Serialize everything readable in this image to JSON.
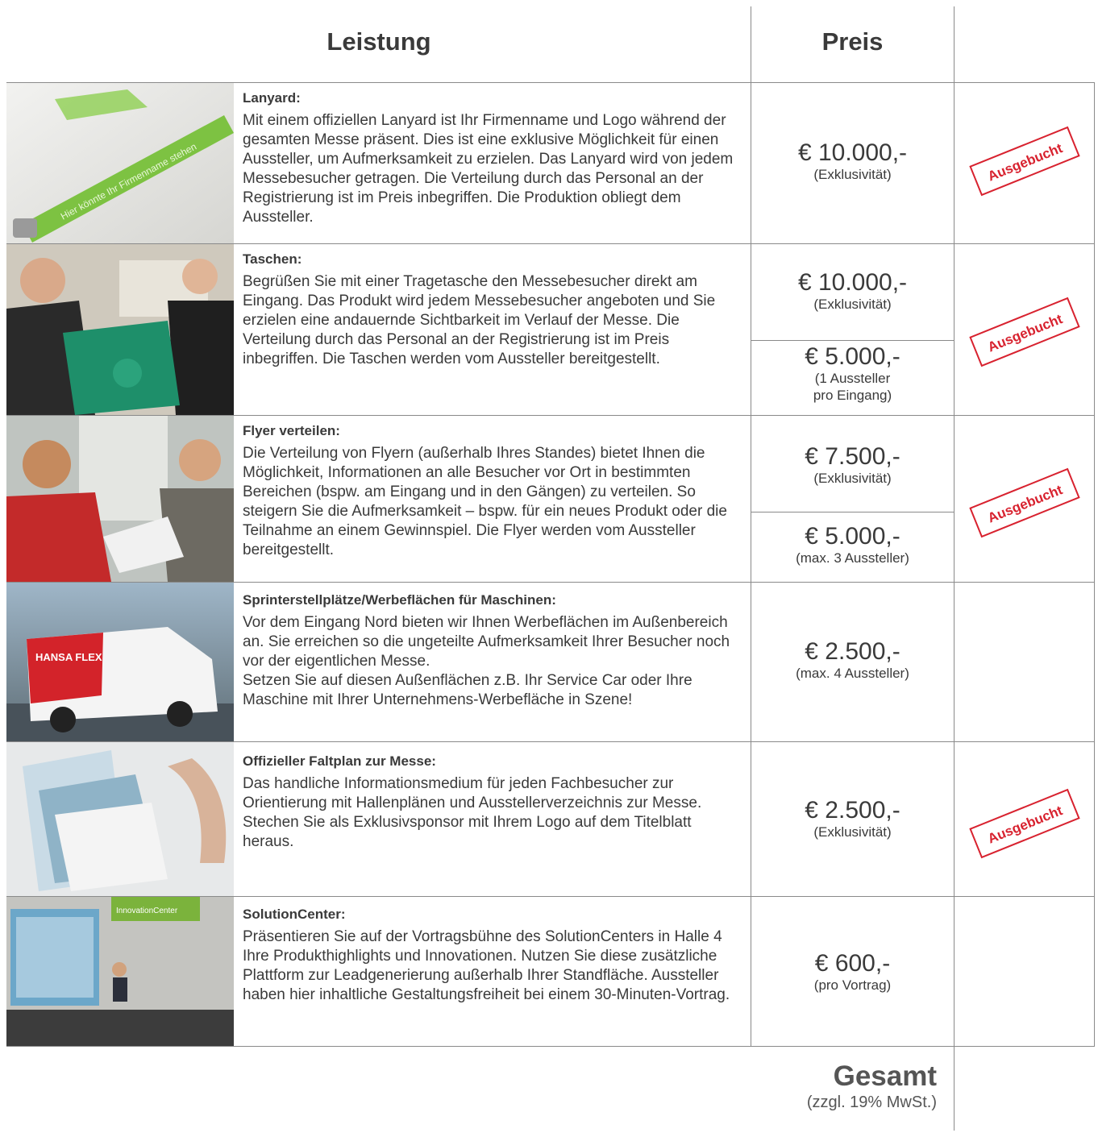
{
  "header": {
    "leistung": "Leistung",
    "preis": "Preis"
  },
  "rows": [
    {
      "title": "Lanyard:",
      "text": "Mit einem offiziellen Lanyard ist Ihr Firmenname und Logo während der gesamten Messe präsent. Dies ist eine exklusive Möglichkeit für einen Aussteller, um Aufmerksamkeit zu erzielen. Das Lanyard wird von jedem Messebesucher getragen. Die Verteilung durch das Personal an der Registrierung ist im Preis inbegriffen. Die Produktion obliegt dem Aussteller.",
      "lanyard_print": "Hier könnte Ihr Firmenname stehen",
      "prices": [
        {
          "amount": "€ 10.000,-",
          "note": "(Exklusivität)"
        }
      ],
      "status": "Ausgebucht"
    },
    {
      "title": "Taschen:",
      "text": "Begrüßen Sie mit einer Tragetasche den Messebesucher direkt am Eingang. Das Produkt wird jedem Messebesucher angeboten und Sie erzielen eine andauernde Sichtbarkeit im Verlauf der Messe. Die Verteilung durch das Personal an der Registrierung ist im Preis inbegriffen. Die Taschen werden vom Aussteller bereitgestellt.",
      "prices": [
        {
          "amount": "€ 10.000,-",
          "note": "(Exklusivität)"
        },
        {
          "amount": "€ 5.000,-",
          "note": "(1 Aussteller\npro Eingang)"
        }
      ],
      "status": "Ausgebucht"
    },
    {
      "title": "Flyer verteilen:",
      "text": "Die Verteilung von Flyern (außerhalb Ihres Standes) bietet Ihnen die Möglichkeit, Informationen an alle Besucher vor Ort in bestimmten Bereichen (bspw. am Eingang und in den Gängen) zu verteilen. So steigern Sie die Aufmerksamkeit – bspw. für ein neues Produkt oder die Teilnahme an einem Gewinnspiel. Die Flyer werden vom Aussteller bereitgestellt.",
      "prices": [
        {
          "amount": "€ 7.500,-",
          "note": "(Exklusivität)"
        },
        {
          "amount": "€ 5.000,-",
          "note": "(max. 3 Aussteller)"
        }
      ],
      "status": "Ausgebucht"
    },
    {
      "title": "Sprinterstellplätze/Werbeflächen für Maschinen:",
      "text": "Vor dem Eingang Nord bieten wir Ihnen Werbeflächen im Außenbereich an. Sie erreichen so die ungeteilte Aufmerksamkeit Ihrer Besucher noch vor der eigentlichen Messe.\nSetzen Sie auf diesen Außenflächen z.B. Ihr Service Car oder Ihre Maschine mit Ihrer Unternehmens-Werbefläche in Szene!",
      "van_logo": "HANSA FLEX",
      "prices": [
        {
          "amount": "€ 2.500,-",
          "note": "(max. 4 Aussteller)"
        }
      ],
      "status": ""
    },
    {
      "title": "Offizieller Faltplan zur Messe:",
      "text": "Das handliche Informationsmedium für jeden Fachbesucher zur Orientierung mit Hallenplänen und Ausstellerverzeichnis zur Messe. Stechen Sie als Exklusivsponsor mit Ihrem Logo auf dem Titelblatt heraus.",
      "prices": [
        {
          "amount": "€ 2.500,-",
          "note": "(Exklusivität)"
        }
      ],
      "status": "Ausgebucht"
    },
    {
      "title": "SolutionCenter:",
      "text": "Präsentieren Sie auf der Vortragsbühne des SolutionCenters in Halle 4 Ihre Produkthighlights und Innovationen. Nutzen Sie diese zusätzliche Plattform zur Leadgenerierung außerhalb Ihrer Standfläche. Aussteller haben hier inhaltliche Gestaltungsfreiheit bei einem 30-Minuten-Vortrag.",
      "sign": "InnovationCenter",
      "prices": [
        {
          "amount": "€ 600,-",
          "note": "(pro Vortrag)"
        }
      ],
      "status": ""
    }
  ],
  "footer": {
    "total": "Gesamt",
    "vat": "(zzgl. 19% MwSt.)"
  },
  "colors": {
    "stamp": "#d8222f",
    "lanyard": "#7dc242",
    "text": "#3a3a3a"
  }
}
